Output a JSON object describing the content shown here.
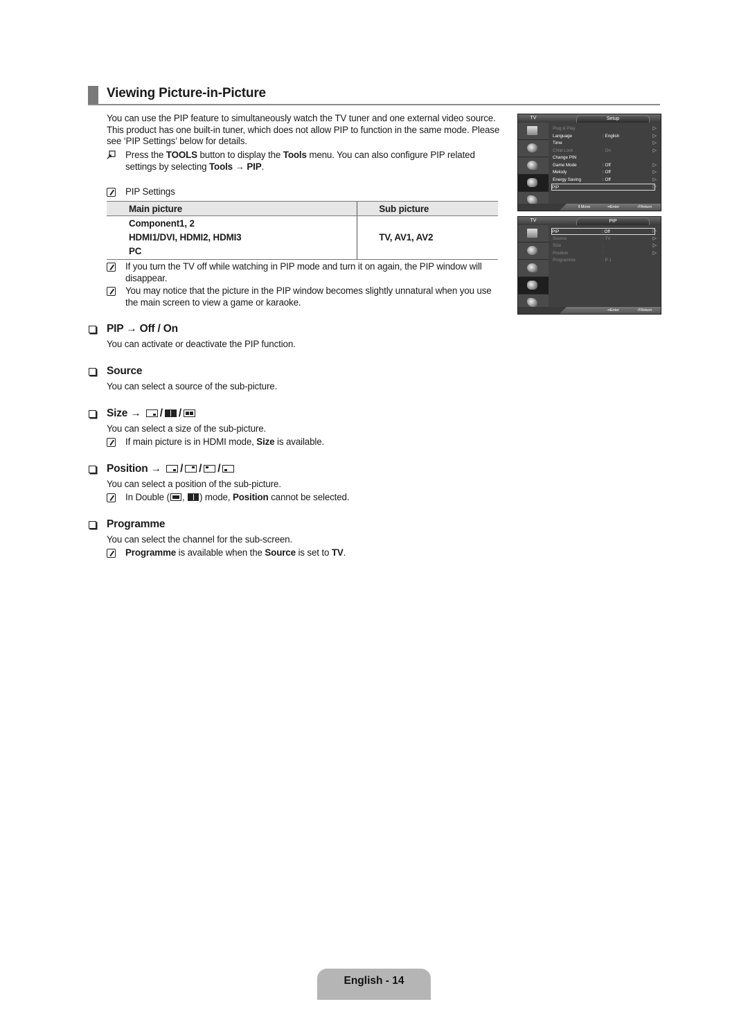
{
  "section_title": "Viewing Picture-in-Picture",
  "intro": {
    "paragraph": "You can use the PIP feature to simultaneously watch the TV tuner and one external video source. This product has one built-in tuner, which does not allow PIP to function in the same mode. Please see ‘PIP Settings’ below for details.",
    "tools_note": {
      "icon": "tools-icon",
      "prefix": "Press the ",
      "tools_bold": "TOOLS",
      "mid1": " button to display the ",
      "tools_menu_bold": "Tools",
      "mid2": " menu. You can also configure PIP related settings by selecting ",
      "path_bold": "Tools → PIP",
      "suffix": "."
    },
    "pip_settings_label": "PIP Settings"
  },
  "pip_table": {
    "headers": [
      "Main picture",
      "Sub picture"
    ],
    "main_picture": [
      "Component1, 2",
      "HDMI1/DVI, HDMI2, HDMI3",
      "PC"
    ],
    "sub_picture": "TV, AV1, AV2"
  },
  "notes": [
    "If you turn the TV off while watching in PIP mode and turn it on again, the PIP window will disappear.",
    "You may notice that the picture in the PIP window becomes slightly unnatural when you use the main screen to view a game or karaoke."
  ],
  "sections": {
    "pip": {
      "heading": "PIP → Off / On",
      "desc": "You can activate or deactivate the PIP function."
    },
    "source": {
      "heading": "Source",
      "desc": "You can select a source of the sub-picture."
    },
    "size": {
      "heading": "Size →",
      "options": [
        "small",
        "double-full",
        "double-half"
      ],
      "desc": "You can select a size of the sub-picture.",
      "note_pre": "If main picture is in HDMI mode, ",
      "note_bold": "Size",
      "note_post": " is available."
    },
    "position": {
      "heading": "Position →",
      "options": [
        "bottom-right",
        "top-right",
        "top-left",
        "bottom-left"
      ],
      "desc": "You can select a position of the sub-picture.",
      "note_pre": "In Double (",
      "note_mid": ", ",
      "note_after": ") mode, ",
      "note_bold": "Position",
      "note_post": " cannot be selected."
    },
    "programme": {
      "heading": "Programme",
      "desc": "You can select the channel for the sub-screen.",
      "note_bold1": "Programme",
      "note_mid1": " is available when the ",
      "note_bold2": "Source",
      "note_mid2": " is set to ",
      "note_bold3": "TV",
      "note_post": "."
    }
  },
  "osd_setup": {
    "source_label": "TV",
    "tab": "Setup",
    "items": [
      {
        "label": "Plug & Play",
        "value": "",
        "dim": true,
        "arrow": true
      },
      {
        "label": "Language",
        "value": ": English",
        "dim": false,
        "arrow": true
      },
      {
        "label": "Time",
        "value": "",
        "dim": false,
        "arrow": true
      },
      {
        "label": "Child Lock",
        "value": ": On",
        "dim": true,
        "arrow": true
      },
      {
        "label": "Change PIN",
        "value": "",
        "dim": false,
        "arrow": false
      },
      {
        "label": "Game Mode",
        "value": ": Off",
        "dim": false,
        "arrow": true
      },
      {
        "label": "Melody",
        "value": ": Off",
        "dim": false,
        "arrow": true
      },
      {
        "label": "Energy Saving",
        "value": ": Off",
        "dim": false,
        "arrow": true
      },
      {
        "label": "PIP",
        "value": "",
        "dim": false,
        "arrow": true,
        "selected": true
      }
    ],
    "footer": {
      "move": "Move",
      "enter": "Enter",
      "return": "Return"
    }
  },
  "osd_pip": {
    "source_label": "TV",
    "tab": "PIP",
    "items": [
      {
        "label": "PIP",
        "value": ": Off",
        "dim": false,
        "arrow": true,
        "selected": true
      },
      {
        "label": "Source",
        "value": ": TV",
        "dim": true,
        "arrow": true
      },
      {
        "label": "Size",
        "value": ":",
        "dim": true,
        "arrow": true
      },
      {
        "label": "Position",
        "value": ":",
        "dim": true,
        "arrow": true
      },
      {
        "label": "Programme",
        "value": ": P 1",
        "dim": true,
        "arrow": false
      }
    ],
    "footer": {
      "enter": "Enter",
      "return": "Return"
    }
  },
  "page_footer": "English - 14"
}
